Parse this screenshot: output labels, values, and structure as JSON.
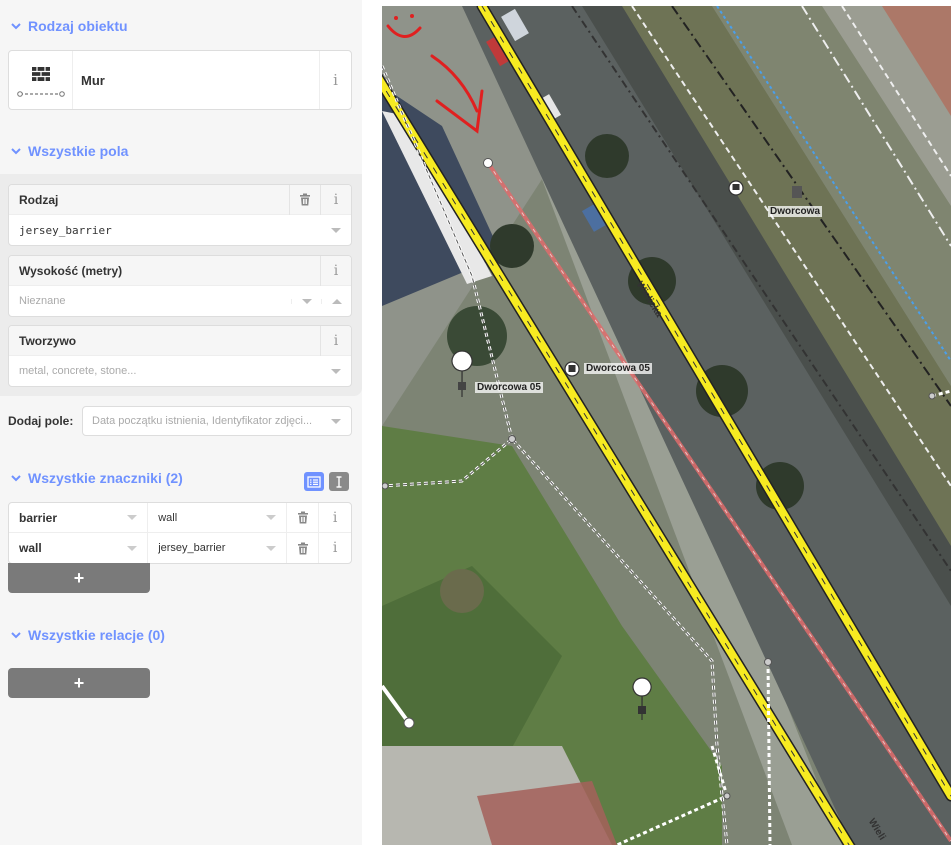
{
  "sidebar": {
    "sections": {
      "type": "Rodzaj obiektu",
      "fields": "Wszystkie pola",
      "tags": "Wszystkie znaczniki (2)",
      "relations": "Wszystkie relacje (0)"
    },
    "preset": {
      "name": "Mur",
      "icon": "wall-preset-icon"
    },
    "fields": [
      {
        "label": "Rodzaj",
        "value": "jersey_barrier"
      },
      {
        "label": "Wysokość (metry)",
        "placeholder": "Nieznane"
      },
      {
        "label": "Tworzywo",
        "placeholder": "metal, concrete, stone..."
      }
    ],
    "add_field": {
      "label": "Dodaj pole:",
      "placeholder": "Data początku istnienia, Identyfikator zdjęci..."
    },
    "tags": [
      {
        "key": "barrier",
        "value": "wall"
      },
      {
        "key": "wall",
        "value": "jersey_barrier"
      }
    ],
    "add_label": "+",
    "info_label": "i",
    "accent_color": "#7092ff"
  },
  "map": {
    "labels": {
      "street_main": "Wielicka",
      "street_bottom": "Wieli",
      "stop_center": "Dworcowa 05",
      "stop_left": "Dworcowa 05",
      "station": "Dworcowa"
    }
  }
}
